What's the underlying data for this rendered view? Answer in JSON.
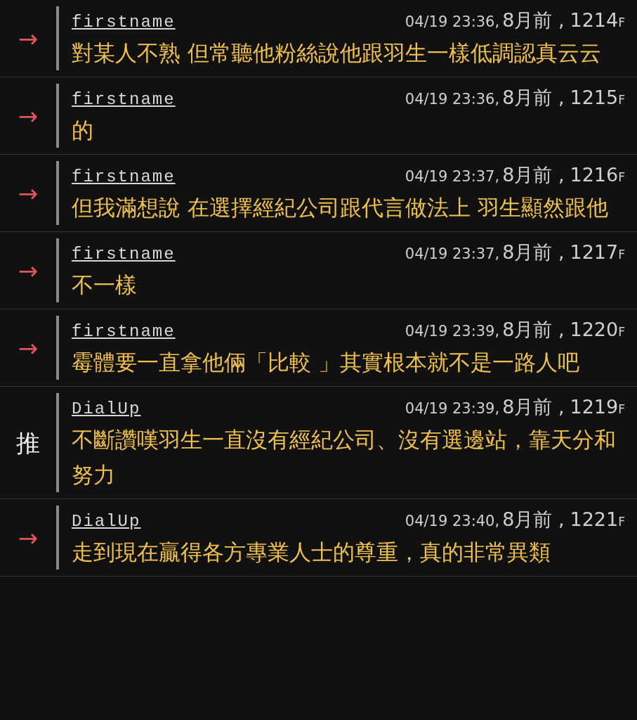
{
  "comments": [
    {
      "tag": "→",
      "kind": "arrow",
      "user": "firstname",
      "date": "04/19 23:36,",
      "ago": "8月前 ,",
      "floor": "1214",
      "floor_suffix": "F",
      "text": "對某人不熟 但常聽他粉絲說他跟羽生一樣低調認真云云"
    },
    {
      "tag": "→",
      "kind": "arrow",
      "user": "firstname",
      "date": "04/19 23:36,",
      "ago": "8月前 ,",
      "floor": "1215",
      "floor_suffix": "F",
      "text": "的"
    },
    {
      "tag": "→",
      "kind": "arrow",
      "user": "firstname",
      "date": "04/19 23:37,",
      "ago": "8月前 ,",
      "floor": "1216",
      "floor_suffix": "F",
      "text": "但我滿想說 在選擇經紀公司跟代言做法上 羽生顯然跟他"
    },
    {
      "tag": "→",
      "kind": "arrow",
      "user": "firstname",
      "date": "04/19 23:37,",
      "ago": "8月前 ,",
      "floor": "1217",
      "floor_suffix": "F",
      "text": "不一樣"
    },
    {
      "tag": "→",
      "kind": "arrow",
      "user": "firstname",
      "date": "04/19 23:39,",
      "ago": "8月前 ,",
      "floor": "1220",
      "floor_suffix": "F",
      "text": "霉體要一直拿他倆「比較 」其實根本就不是一路人吧"
    },
    {
      "tag": "推",
      "kind": "push",
      "user": "DialUp",
      "date": "04/19 23:39,",
      "ago": "8月前 ,",
      "floor": "1219",
      "floor_suffix": "F",
      "text": "不斷讚嘆羽生一直沒有經紀公司、沒有選邊站，靠天分和努力"
    },
    {
      "tag": "→",
      "kind": "arrow",
      "user": "DialUp",
      "date": "04/19 23:40,",
      "ago": "8月前 ,",
      "floor": "1221",
      "floor_suffix": "F",
      "text": "走到現在贏得各方專業人士的尊重，真的非常異類"
    }
  ]
}
